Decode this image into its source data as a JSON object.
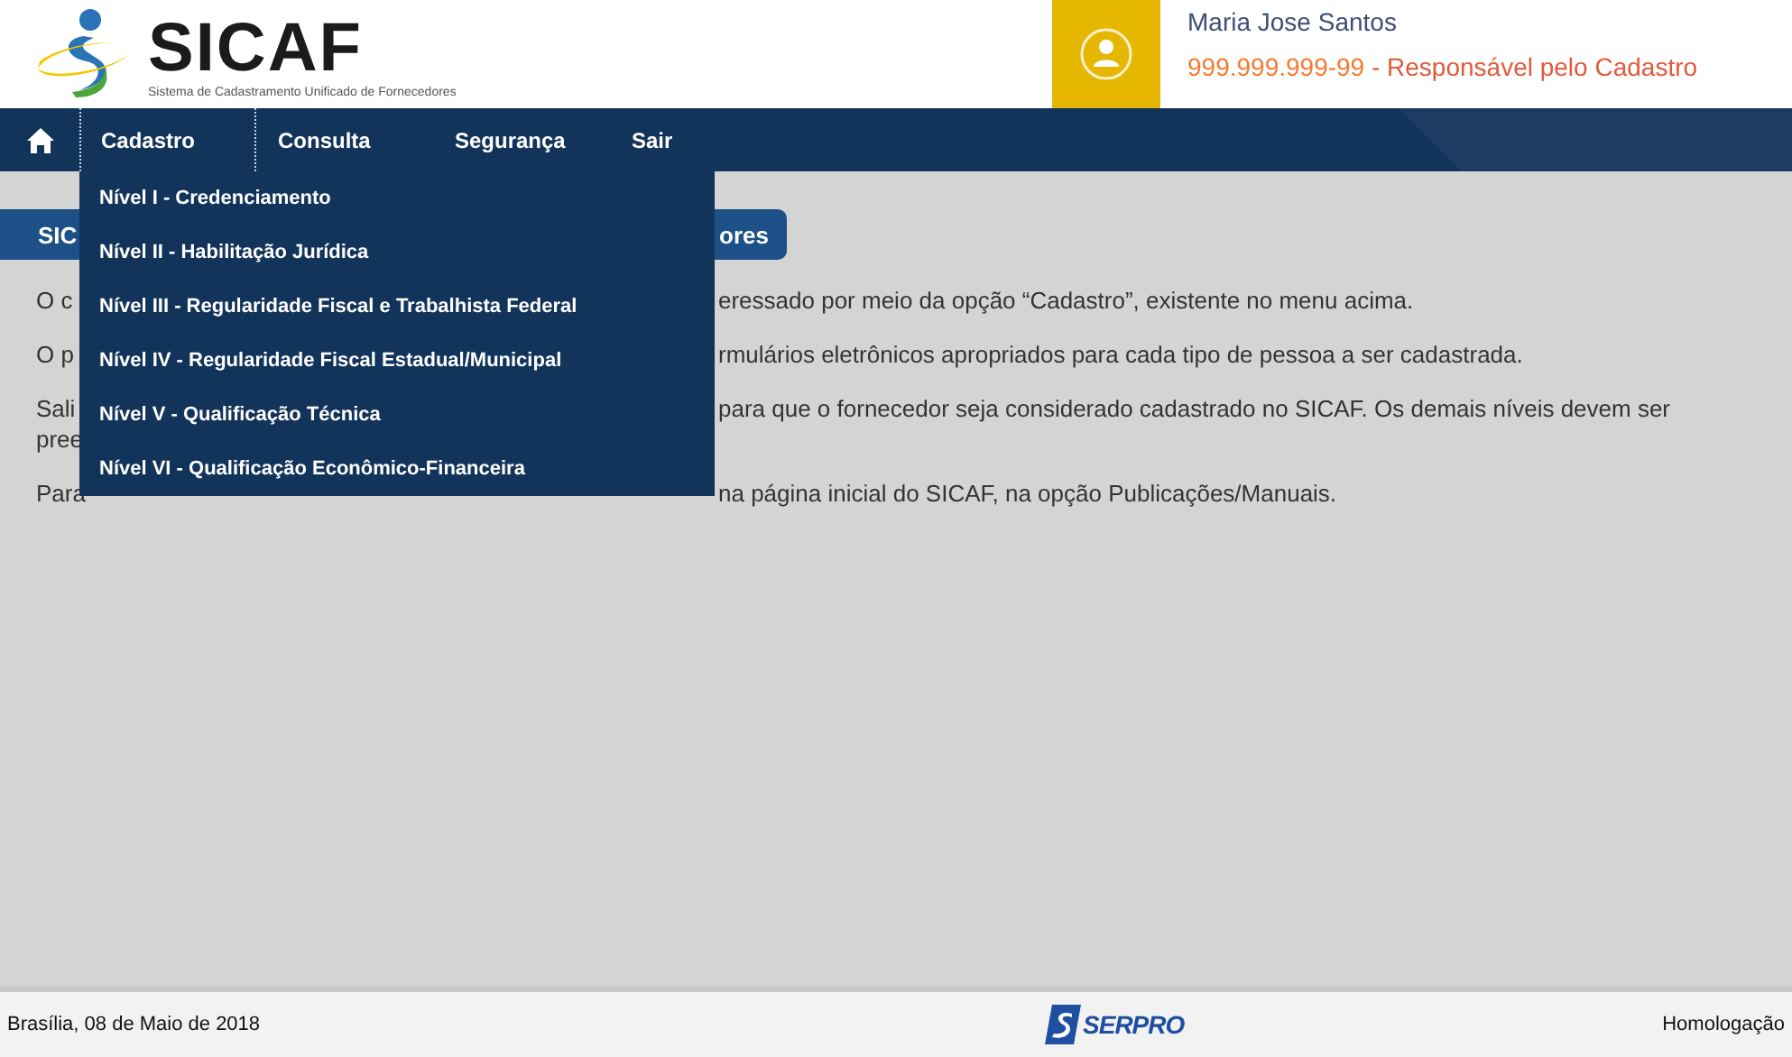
{
  "header": {
    "logo_title": "SICAF",
    "logo_subtitle": "Sistema de Cadastramento Unificado de Fornecedores"
  },
  "user": {
    "name": "Maria Jose Santos",
    "document": "999.999.999-99",
    "role": " - Responsável pelo Cadastro"
  },
  "nav": {
    "items": [
      {
        "label": "Cadastro",
        "expanded": true
      },
      {
        "label": "Consulta",
        "expanded": false
      },
      {
        "label": "Segurança",
        "expanded": false
      },
      {
        "label": "Sair",
        "expanded": false
      }
    ],
    "dropdown": [
      "Nível I - Credenciamento",
      "Nível II - Habilitação Jurídica",
      "Nível III - Regularidade Fiscal e Trabalhista Federal",
      "Nível IV - Regularidade Fiscal Estadual/Municipal",
      "Nível V - Qualificação Técnica",
      "Nível VI - Qualificação Econômico-Financeira"
    ]
  },
  "page": {
    "title": [
      "SIC",
      "ores"
    ],
    "paragraphs": [
      {
        "left": [
          "O c"
        ],
        "right": "eressado por meio da opção “Cadastro”, existente no menu acima."
      },
      {
        "left": [
          "O p"
        ],
        "right": "rmulários eletrônicos apropriados para cada tipo de pessoa a ser cadastrada."
      },
      {
        "left": [
          "Sali",
          "pree"
        ],
        "right": "para que o fornecedor seja considerado cadastrado no SICAF. Os demais níveis devem ser"
      },
      {
        "left": [
          "Para"
        ],
        "right": "na página inicial do SICAF, na opção Publicações/Manuais."
      }
    ]
  },
  "footer": {
    "date": "Brasília, 08 de Maio de 2018",
    "brand": "SERPRO",
    "environment": "Homologação"
  }
}
